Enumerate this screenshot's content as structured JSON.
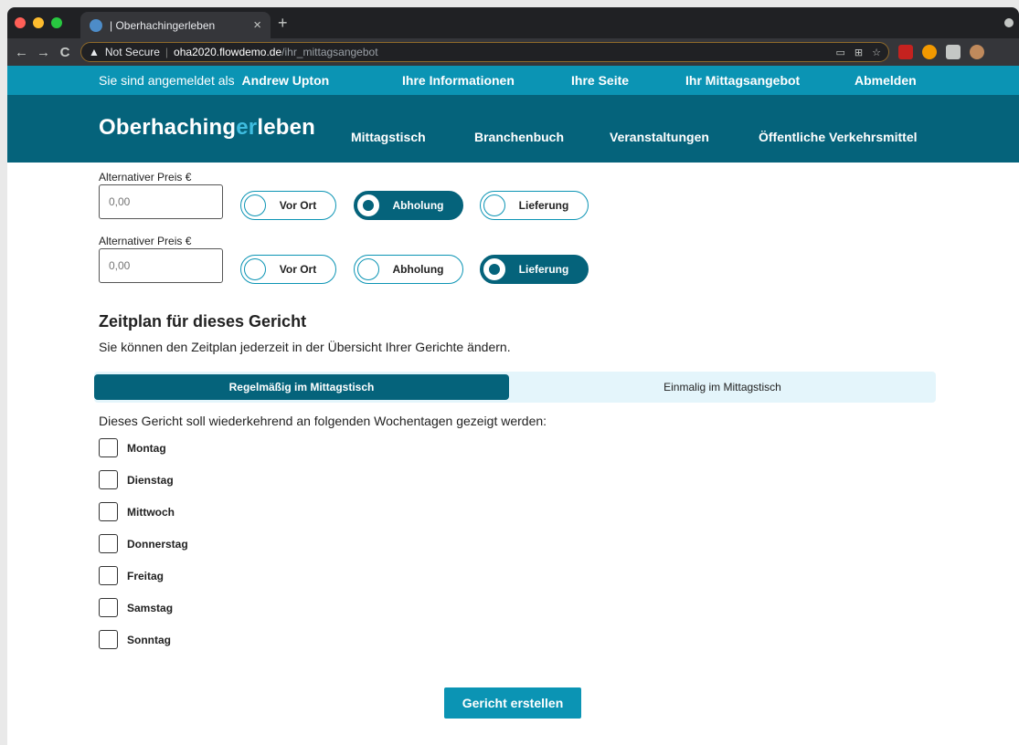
{
  "browser": {
    "tab_title": "| Oberhachingerleben",
    "tab_close": "×",
    "new_tab": "+",
    "back": "←",
    "forward": "→",
    "reload": "C",
    "security_icon": "▲",
    "security_label": "Not Secure",
    "url_host": "oha2020.flowdemo.de",
    "url_path": "/ihr_mittagsangebot",
    "traffic_colors": [
      "#ff5f57",
      "#febc2e",
      "#28c840"
    ],
    "extension_colors": [
      "#c5221f",
      "#f29900",
      "#c4c7c5",
      "#c08a5c"
    ]
  },
  "topbar": {
    "login_prefix": "Sie sind angemeldet als",
    "user_name": "Andrew Upton",
    "links": [
      "Ihre Informationen",
      "Ihre Seite",
      "Ihr Mittagsangebot",
      "Abmelden"
    ]
  },
  "mainnav": {
    "logo_part1": "Oberhaching",
    "logo_part2": "er",
    "logo_part3": "leben",
    "links": [
      "Mittagstisch",
      "Branchenbuch",
      "Veranstaltungen",
      "Öffentliche Verkehrsmittel"
    ]
  },
  "price_rows": [
    {
      "label": "Alternativer Preis €",
      "placeholder": "0,00",
      "options": [
        "Vor Ort",
        "Abholung",
        "Lieferung"
      ],
      "selected": "Abholung"
    },
    {
      "label": "Alternativer Preis €",
      "placeholder": "0,00",
      "options": [
        "Vor Ort",
        "Abholung",
        "Lieferung"
      ],
      "selected": "Lieferung"
    }
  ],
  "schedule": {
    "title": "Zeitplan für dieses Gericht",
    "subtitle": "Sie können den Zeitplan jederzeit in der Übersicht Ihrer Gerichte ändern.",
    "tab_regular": "Regelmäßig im Mittagstisch",
    "tab_once": "Einmalig im Mittagstisch",
    "intro": "Dieses Gericht soll wiederkehrend an folgenden Wochentagen gezeigt werden:",
    "days": [
      "Montag",
      "Dienstag",
      "Mittwoch",
      "Donnerstag",
      "Freitag",
      "Samstag",
      "Sonntag"
    ]
  },
  "submit_label": "Gericht erstellen",
  "colors": {
    "accent": "#0b94b4",
    "dark": "#05637b",
    "tab_bg": "#e4f5fb"
  }
}
